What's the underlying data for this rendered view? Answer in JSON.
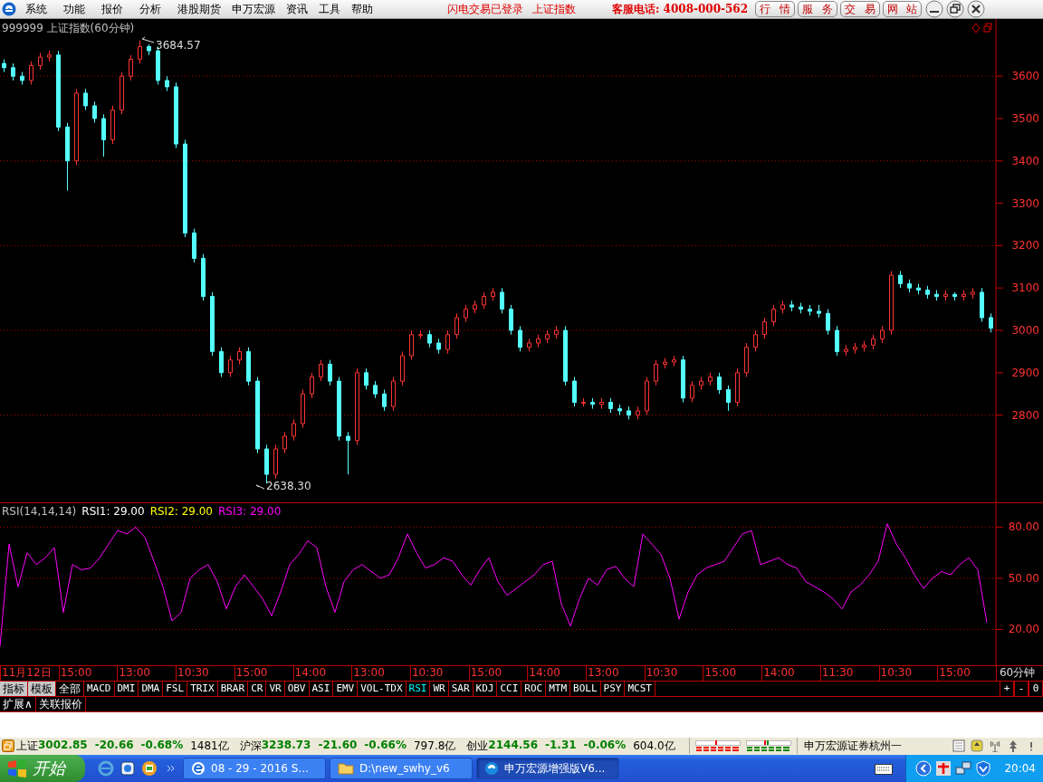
{
  "menu_bar": {
    "items": [
      "系统",
      "功能",
      "报价",
      "分析",
      "港股期货",
      "申万宏源",
      "资讯",
      "工具",
      "帮助"
    ],
    "status_texts": [
      "闪电交易已登录",
      "上证指数"
    ],
    "hotline": "客服电话: 4008-000-562",
    "buttons": [
      "行 情",
      "服 务",
      "交 易",
      "网 站"
    ]
  },
  "price_chart": {
    "title": "999999 上证指数(60分钟)",
    "high_label": "3684.57",
    "low_label": "2638.30",
    "chart_data": {
      "type": "candlestick",
      "ylim": [
        2594,
        3735
      ],
      "yticks": [
        {
          "value": 3600,
          "label": "3600"
        },
        {
          "value": 3500,
          "label": "3500"
        },
        {
          "value": 3400,
          "label": "3400"
        },
        {
          "value": 3300,
          "label": "3300"
        },
        {
          "value": 3200,
          "label": "3200"
        },
        {
          "value": 3100,
          "label": "3100"
        },
        {
          "value": 3000,
          "label": "3000"
        },
        {
          "value": 2900,
          "label": "2900"
        },
        {
          "value": 2800,
          "label": "2800"
        }
      ],
      "grid": true,
      "ohlc": [
        [
          3630,
          3640,
          3610,
          3620
        ],
        [
          3620,
          3630,
          3590,
          3600
        ],
        [
          3600,
          3610,
          3580,
          3590
        ],
        [
          3590,
          3635,
          3580,
          3625
        ],
        [
          3625,
          3655,
          3615,
          3645
        ],
        [
          3645,
          3660,
          3635,
          3650
        ],
        [
          3650,
          3660,
          3470,
          3480
        ],
        [
          3480,
          3490,
          3330,
          3400
        ],
        [
          3400,
          3570,
          3390,
          3560
        ],
        [
          3560,
          3570,
          3520,
          3530
        ],
        [
          3530,
          3540,
          3490,
          3500
        ],
        [
          3500,
          3510,
          3410,
          3450
        ],
        [
          3450,
          3530,
          3440,
          3520
        ],
        [
          3520,
          3610,
          3510,
          3600
        ],
        [
          3600,
          3650,
          3590,
          3640
        ],
        [
          3640,
          3684.57,
          3630,
          3670
        ],
        [
          3670,
          3675,
          3650,
          3660
        ],
        [
          3660,
          3670,
          3580,
          3590
        ],
        [
          3590,
          3600,
          3565,
          3575
        ],
        [
          3575,
          3585,
          3430,
          3440
        ],
        [
          3440,
          3450,
          3220,
          3230
        ],
        [
          3230,
          3240,
          3160,
          3170
        ],
        [
          3170,
          3180,
          3070,
          3080
        ],
        [
          3080,
          3090,
          2940,
          2950
        ],
        [
          2950,
          2960,
          2890,
          2900
        ],
        [
          2900,
          2940,
          2890,
          2930
        ],
        [
          2930,
          2960,
          2920,
          2950
        ],
        [
          2950,
          2960,
          2870,
          2880
        ],
        [
          2880,
          2890,
          2710,
          2720
        ],
        [
          2720,
          2730,
          2638.3,
          2660
        ],
        [
          2660,
          2730,
          2650,
          2720
        ],
        [
          2720,
          2760,
          2710,
          2750
        ],
        [
          2750,
          2790,
          2740,
          2780
        ],
        [
          2780,
          2860,
          2770,
          2850
        ],
        [
          2850,
          2900,
          2840,
          2890
        ],
        [
          2890,
          2930,
          2880,
          2920
        ],
        [
          2920,
          2930,
          2870,
          2880
        ],
        [
          2880,
          2890,
          2740,
          2750
        ],
        [
          2750,
          2760,
          2660,
          2740
        ],
        [
          2740,
          2910,
          2730,
          2900
        ],
        [
          2900,
          2910,
          2860,
          2870
        ],
        [
          2870,
          2880,
          2840,
          2850
        ],
        [
          2850,
          2860,
          2810,
          2820
        ],
        [
          2820,
          2890,
          2810,
          2880
        ],
        [
          2880,
          2950,
          2870,
          2940
        ],
        [
          2940,
          3000,
          2930,
          2990
        ],
        [
          2990,
          3000,
          2980,
          2990
        ],
        [
          2990,
          3000,
          2960,
          2970
        ],
        [
          2970,
          2980,
          2945,
          2955
        ],
        [
          2955,
          3000,
          2945,
          2990
        ],
        [
          2990,
          3040,
          2980,
          3030
        ],
        [
          3030,
          3060,
          3020,
          3050
        ],
        [
          3050,
          3070,
          3040,
          3060
        ],
        [
          3060,
          3090,
          3050,
          3080
        ],
        [
          3080,
          3100,
          3070,
          3090
        ],
        [
          3090,
          3100,
          3040,
          3050
        ],
        [
          3050,
          3060,
          2990,
          3000
        ],
        [
          3000,
          3010,
          2950,
          2960
        ],
        [
          2960,
          2980,
          2950,
          2970
        ],
        [
          2970,
          2990,
          2960,
          2980
        ],
        [
          2980,
          3000,
          2970,
          2990
        ],
        [
          2990,
          3010,
          2980,
          3000
        ],
        [
          3000,
          3010,
          2870,
          2880
        ],
        [
          2880,
          2890,
          2820,
          2830
        ],
        [
          2830,
          2840,
          2820,
          2830
        ],
        [
          2830,
          2840,
          2815,
          2825
        ],
        [
          2825,
          2840,
          2815,
          2830
        ],
        [
          2830,
          2840,
          2805,
          2815
        ],
        [
          2815,
          2825,
          2800,
          2810
        ],
        [
          2810,
          2820,
          2790,
          2800
        ],
        [
          2800,
          2820,
          2790,
          2810
        ],
        [
          2810,
          2890,
          2800,
          2880
        ],
        [
          2880,
          2930,
          2870,
          2920
        ],
        [
          2920,
          2935,
          2910,
          2925
        ],
        [
          2925,
          2940,
          2915,
          2930
        ],
        [
          2930,
          2940,
          2830,
          2840
        ],
        [
          2840,
          2880,
          2830,
          2870
        ],
        [
          2870,
          2890,
          2860,
          2880
        ],
        [
          2880,
          2900,
          2870,
          2890
        ],
        [
          2890,
          2900,
          2850,
          2860
        ],
        [
          2860,
          2870,
          2810,
          2830
        ],
        [
          2830,
          2910,
          2820,
          2900
        ],
        [
          2900,
          2970,
          2890,
          2960
        ],
        [
          2960,
          3000,
          2950,
          2990
        ],
        [
          2990,
          3030,
          2980,
          3020
        ],
        [
          3020,
          3060,
          3010,
          3050
        ],
        [
          3050,
          3070,
          3040,
          3060
        ],
        [
          3060,
          3070,
          3045,
          3055
        ],
        [
          3055,
          3065,
          3040,
          3050
        ],
        [
          3050,
          3060,
          3035,
          3045
        ],
        [
          3045,
          3060,
          3030,
          3040
        ],
        [
          3040,
          3050,
          2990,
          3000
        ],
        [
          3000,
          3010,
          2940,
          2950
        ],
        [
          2950,
          2965,
          2940,
          2955
        ],
        [
          2955,
          2970,
          2945,
          2960
        ],
        [
          2960,
          2975,
          2950,
          2965
        ],
        [
          2965,
          2990,
          2955,
          2980
        ],
        [
          2980,
          3010,
          2970,
          3000
        ],
        [
          3000,
          3140,
          2990,
          3130
        ],
        [
          3130,
          3140,
          3100,
          3110
        ],
        [
          3110,
          3120,
          3090,
          3100
        ],
        [
          3100,
          3110,
          3085,
          3095
        ],
        [
          3095,
          3105,
          3075,
          3085
        ],
        [
          3085,
          3095,
          3070,
          3080
        ],
        [
          3080,
          3095,
          3070,
          3085
        ],
        [
          3085,
          3090,
          3070,
          3080
        ],
        [
          3080,
          3095,
          3070,
          3085
        ],
        [
          3085,
          3100,
          3075,
          3090
        ],
        [
          3090,
          3100,
          3020,
          3030
        ],
        [
          3030,
          3040,
          2995,
          3005
        ]
      ]
    }
  },
  "rsi_chart": {
    "title": "RSI(14,14,14)",
    "lines": [
      {
        "label": "RSI1: 29.00",
        "color": "#ffffff"
      },
      {
        "label": "RSI2: 29.00",
        "color": "#ffff00"
      },
      {
        "label": "RSI3: 29.00",
        "color": "#ff00ff"
      }
    ],
    "chart_data": {
      "type": "line",
      "ylim": [
        -1,
        94
      ],
      "grid": true,
      "yticks": [
        {
          "value": 80,
          "label": "80.00"
        },
        {
          "value": 50,
          "label": "50.00"
        },
        {
          "value": 20,
          "label": "20.00"
        }
      ],
      "series": [
        {
          "color": "#ff00ff",
          "values": [
            10,
            70,
            45,
            65,
            58,
            62,
            68,
            30,
            58,
            55,
            56,
            62,
            70,
            78,
            76,
            80,
            74,
            60,
            45,
            25,
            30,
            50,
            55,
            58,
            48,
            32,
            45,
            52,
            45,
            38,
            28,
            42,
            58,
            64,
            72,
            68,
            45,
            30,
            48,
            55,
            58,
            54,
            50,
            52,
            62,
            76,
            65,
            56,
            58,
            62,
            60,
            52,
            46,
            55,
            62,
            48,
            40,
            44,
            48,
            52,
            58,
            60,
            35,
            22,
            38,
            50,
            46,
            55,
            57,
            50,
            45,
            76,
            70,
            64,
            50,
            26,
            42,
            52,
            56,
            58,
            60,
            68,
            76,
            78,
            58,
            60,
            62,
            58,
            56,
            48,
            45,
            42,
            38,
            32,
            42,
            46,
            52,
            60,
            82,
            70,
            62,
            52,
            44,
            50,
            54,
            52,
            58,
            62,
            55,
            24
          ]
        }
      ]
    }
  },
  "time_axis": {
    "labels": [
      "11月12日",
      "15:00",
      "13:00",
      "10:30",
      "15:00",
      "14:00",
      "13:00",
      "10:30",
      "15:00",
      "14:00",
      "13:00",
      "10:30",
      "15:00",
      "14:00",
      "11:30",
      "10:30",
      "15:00"
    ],
    "period": "60分钟"
  },
  "indicator_tabs": [
    {
      "label": "指标",
      "kind": "mode",
      "selected": false
    },
    {
      "label": "模板",
      "kind": "mode",
      "selected": false
    },
    {
      "label": "全部",
      "kind": "tab",
      "selected": false
    },
    {
      "label": "MACD",
      "kind": "tab",
      "selected": false
    },
    {
      "label": "DMI",
      "kind": "tab",
      "selected": false
    },
    {
      "label": "DMA",
      "kind": "tab",
      "selected": false
    },
    {
      "label": "FSL",
      "kind": "tab",
      "selected": false
    },
    {
      "label": "TRIX",
      "kind": "tab",
      "selected": false
    },
    {
      "label": "BRAR",
      "kind": "tab",
      "selected": false
    },
    {
      "label": "CR",
      "kind": "tab",
      "selected": false
    },
    {
      "label": "VR",
      "kind": "tab",
      "selected": false
    },
    {
      "label": "OBV",
      "kind": "tab",
      "selected": false
    },
    {
      "label": "ASI",
      "kind": "tab",
      "selected": false
    },
    {
      "label": "EMV",
      "kind": "tab",
      "selected": false
    },
    {
      "label": "VOL-TDX",
      "kind": "tab",
      "selected": false
    },
    {
      "label": "RSI",
      "kind": "tab",
      "selected": true
    },
    {
      "label": "WR",
      "kind": "tab",
      "selected": false
    },
    {
      "label": "SAR",
      "kind": "tab",
      "selected": false
    },
    {
      "label": "KDJ",
      "kind": "tab",
      "selected": false
    },
    {
      "label": "CCI",
      "kind": "tab",
      "selected": false
    },
    {
      "label": "ROC",
      "kind": "tab",
      "selected": false
    },
    {
      "label": "MTM",
      "kind": "tab",
      "selected": false
    },
    {
      "label": "BOLL",
      "kind": "tab",
      "selected": false
    },
    {
      "label": "PSY",
      "kind": "tab",
      "selected": false
    },
    {
      "label": "MCST",
      "kind": "tab",
      "selected": false
    }
  ],
  "zoom_buttons": [
    "+",
    "-",
    "0"
  ],
  "sub_tabs": [
    "扩展∧",
    "关联报价"
  ],
  "market_bar": {
    "indices": [
      {
        "name": "上证",
        "value": "3002.85",
        "change": "-20.66",
        "percent": "-0.68%",
        "turnover": "1481亿"
      },
      {
        "name": "沪深",
        "value": "3238.73",
        "change": "-21.60",
        "percent": "-0.66%",
        "turnover": "797.8亿"
      },
      {
        "name": "创业",
        "value": "2144.56",
        "change": "-1.31",
        "percent": "-0.06%",
        "turnover": "604.0亿"
      }
    ],
    "broker": "申万宏源证券杭州一"
  },
  "taskbar": {
    "start": "开始",
    "tasks": [
      {
        "label": "08 - 29 - 2016 S...",
        "kind": "browser",
        "selected": false
      },
      {
        "label": "D:\\new_swhy_v6",
        "kind": "folder",
        "selected": false
      },
      {
        "label": "申万宏源增强版V6...",
        "kind": "app",
        "selected": true
      }
    ],
    "clock": "20:04"
  }
}
